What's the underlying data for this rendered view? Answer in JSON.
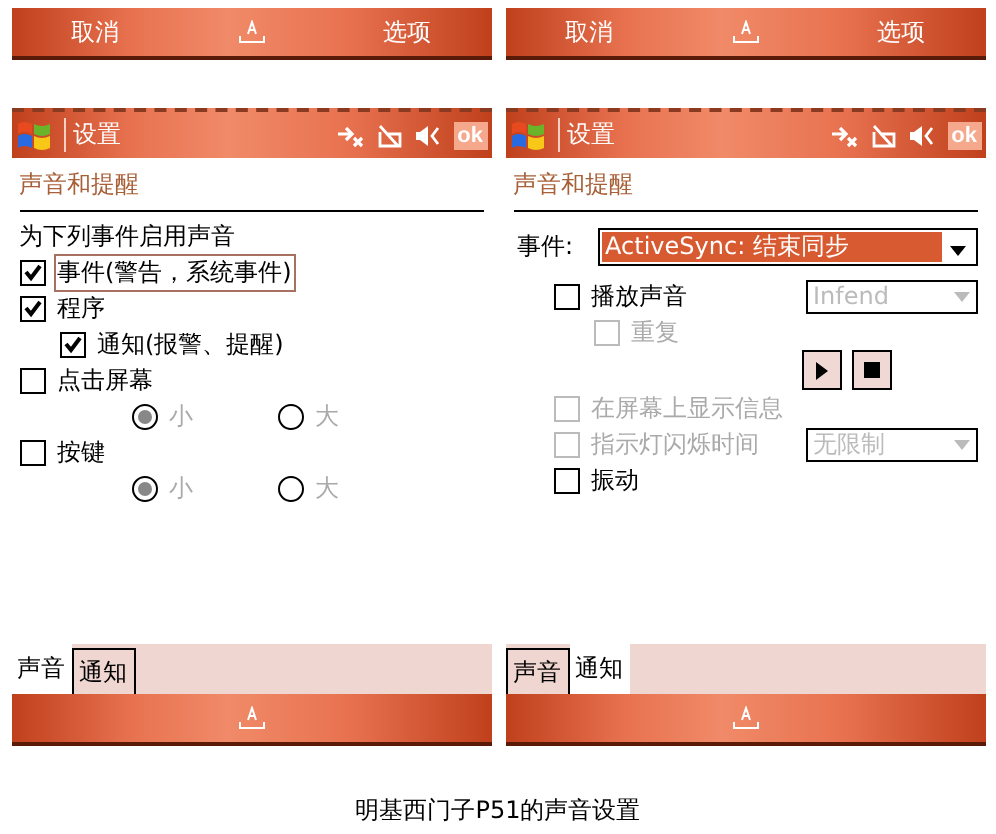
{
  "screens": [
    {
      "kind": "sound",
      "softkeys": [
        "取消",
        "选项"
      ],
      "title": "设置",
      "ok": "ok",
      "heading": "声音和提醒",
      "intro": "为下列事件启用声音",
      "options": [
        {
          "kind": "check",
          "label": "事件(警告，系统事件)",
          "checked": true,
          "focused": true,
          "disabled": false
        },
        {
          "kind": "check",
          "label": "程序",
          "checked": true,
          "focused": false,
          "disabled": false,
          "children": [
            {
              "kind": "check",
              "label": "通知(报警、提醒)",
              "checked": true,
              "focused": false,
              "disabled": false
            }
          ]
        },
        {
          "kind": "check",
          "label": "点击屏幕",
          "checked": false,
          "focused": false,
          "disabled": false,
          "children": [
            {
              "kind": "radios",
              "disabled": true,
              "choices": [
                {
                  "label": "小",
                  "selected": true
                },
                {
                  "label": "大",
                  "selected": false
                }
              ]
            }
          ]
        },
        {
          "kind": "check",
          "label": "按键",
          "checked": false,
          "focused": false,
          "disabled": false,
          "children": [
            {
              "kind": "radios",
              "disabled": true,
              "choices": [
                {
                  "label": "小",
                  "selected": true
                },
                {
                  "label": "大",
                  "selected": false
                }
              ]
            }
          ]
        }
      ],
      "tabs": [
        {
          "label": "声音",
          "selected": true
        },
        {
          "label": "通知",
          "selected": false
        }
      ]
    },
    {
      "kind": "notify",
      "softkeys": [
        "取消",
        "选项"
      ],
      "title": "设置",
      "ok": "ok",
      "heading": "声音和提醒",
      "event": {
        "label": "事件:",
        "value": "ActiveSync: 结束同步"
      },
      "options": [
        {
          "kind": "check",
          "label": "播放声音",
          "checked": false,
          "disabled": false,
          "select": {
            "value": "Infend",
            "disabled": true
          },
          "children": [
            {
              "kind": "check",
              "label": "重复",
              "checked": false,
              "disabled": true
            },
            {
              "kind": "media"
            }
          ]
        },
        {
          "kind": "check",
          "label": "在屏幕上显示信息",
          "checked": false,
          "disabled": true
        },
        {
          "kind": "check",
          "label": "指示灯闪烁时间",
          "checked": false,
          "disabled": true,
          "select": {
            "value": "无限制",
            "disabled": true
          }
        },
        {
          "kind": "check",
          "label": "振动",
          "checked": false,
          "disabled": false
        }
      ],
      "tabs": [
        {
          "label": "声音",
          "selected": false
        },
        {
          "label": "通知",
          "selected": true
        }
      ]
    }
  ],
  "caption": "明基西门子P51的声音设置"
}
